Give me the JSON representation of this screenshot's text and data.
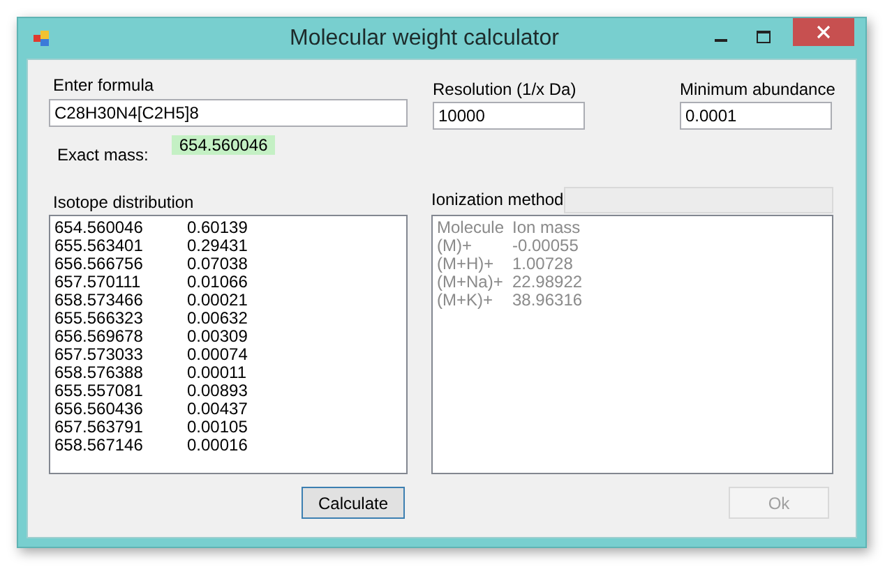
{
  "window": {
    "title": "Molecular weight calculator"
  },
  "formula": {
    "label": "Enter formula",
    "value": "C28H30N4[C2H5]8"
  },
  "resolution": {
    "label": "Resolution (1/x Da)",
    "value": "10000"
  },
  "minimum_abundance": {
    "label": "Minimum abundance",
    "value": "0.0001"
  },
  "exact_mass": {
    "label": "Exact mass:",
    "value": "654.560046"
  },
  "isotope_distribution": {
    "label": "Isotope distribution",
    "rows": [
      {
        "mass": "654.560046",
        "abundance": "0.60139"
      },
      {
        "mass": "655.563401",
        "abundance": "0.29431"
      },
      {
        "mass": "656.566756",
        "abundance": "0.07038"
      },
      {
        "mass": "657.570111",
        "abundance": "0.01066"
      },
      {
        "mass": "658.573466",
        "abundance": "0.00021"
      },
      {
        "mass": "655.566323",
        "abundance": "0.00632"
      },
      {
        "mass": "656.569678",
        "abundance": "0.00309"
      },
      {
        "mass": "657.573033",
        "abundance": "0.00074"
      },
      {
        "mass": "658.576388",
        "abundance": "0.00011"
      },
      {
        "mass": "655.557081",
        "abundance": "0.00893"
      },
      {
        "mass": "656.560436",
        "abundance": "0.00437"
      },
      {
        "mass": "657.563791",
        "abundance": "0.00105"
      },
      {
        "mass": "658.567146",
        "abundance": "0.00016"
      }
    ]
  },
  "ionization": {
    "label": "Ionization method",
    "method_disabled": true,
    "list_disabled": true,
    "columns": [
      "Molecule",
      "Ion mass"
    ],
    "rows": [
      {
        "molecule": "(M)+",
        "ion_mass": "-0.00055"
      },
      {
        "molecule": "(M+H)+",
        "ion_mass": "1.00728"
      },
      {
        "molecule": "(M+Na)+",
        "ion_mass": "22.98922"
      },
      {
        "molecule": "(M+K)+",
        "ion_mass": "38.96316"
      }
    ]
  },
  "buttons": [
    {
      "label": "Calculate",
      "disabled": false,
      "focused": true
    },
    {
      "label": "Ok",
      "disabled": true,
      "focused": false
    }
  ]
}
